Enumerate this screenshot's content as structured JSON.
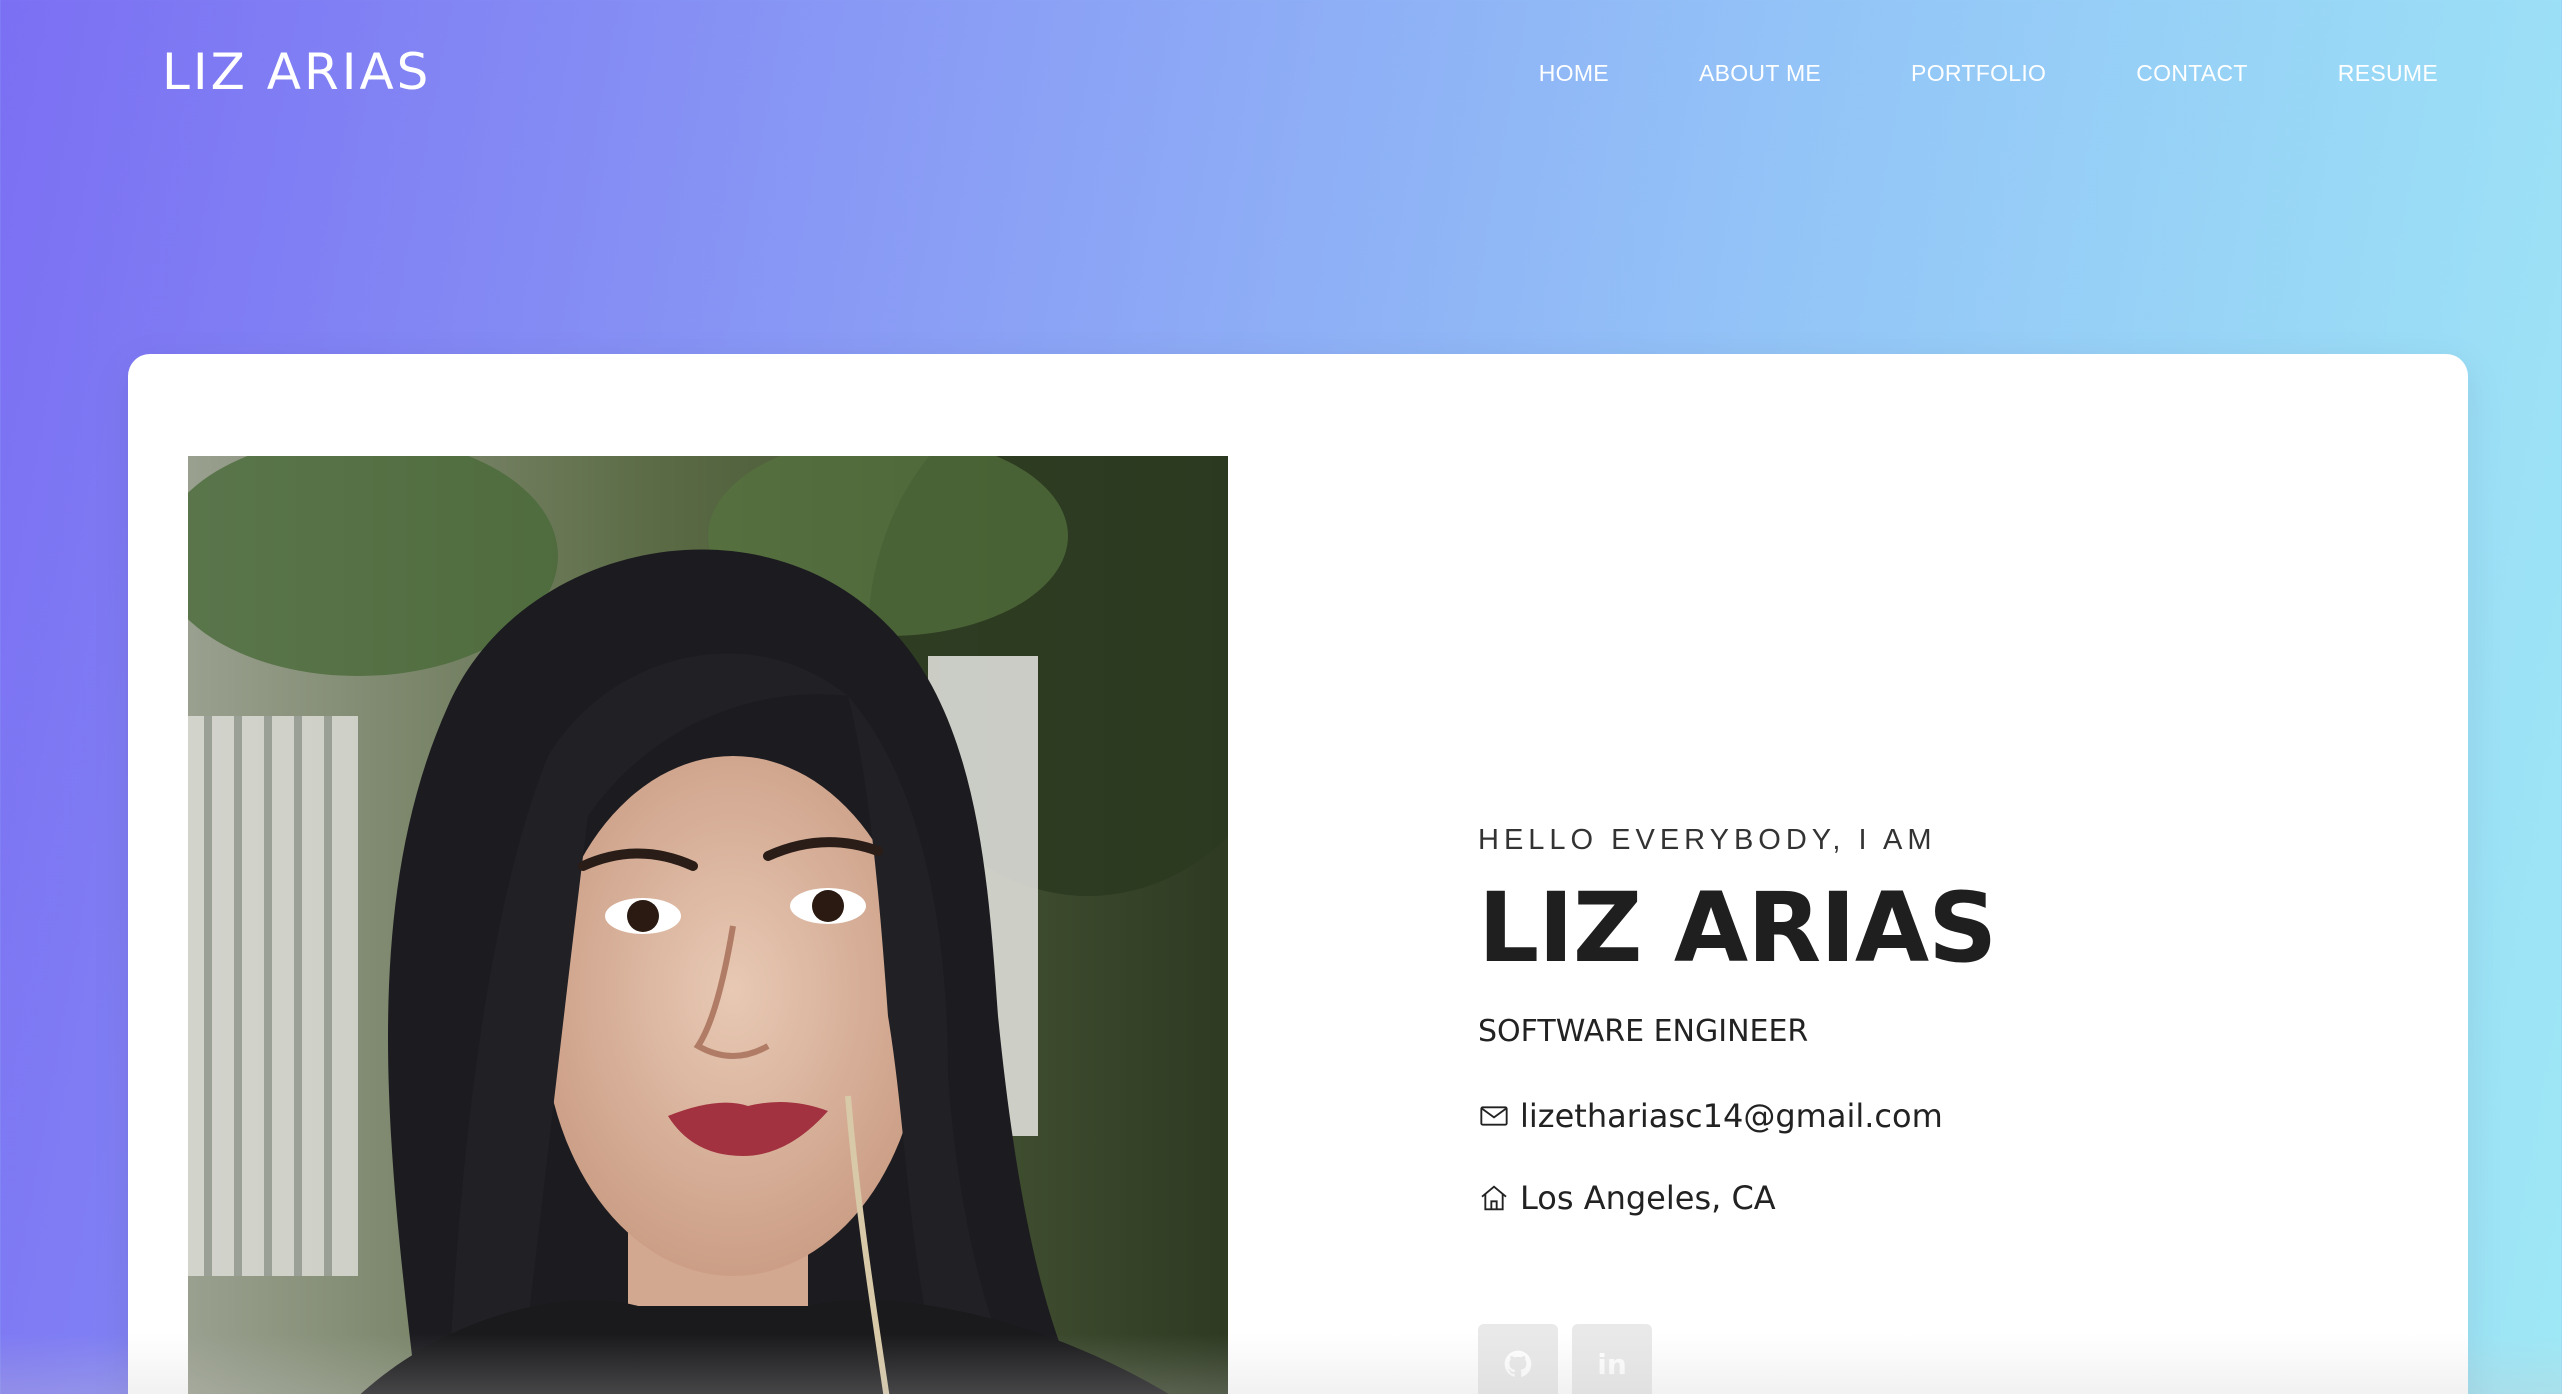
{
  "header": {
    "logo": "LIZ ARIAS",
    "nav": [
      {
        "label": "HOME"
      },
      {
        "label": "ABOUT ME"
      },
      {
        "label": "PORTFOLIO"
      },
      {
        "label": "CONTACT"
      },
      {
        "label": "RESUME"
      }
    ]
  },
  "hero": {
    "greeting": "HELLO EVERYBODY, I AM",
    "name": "LIZ ARIAS",
    "role": "SOFTWARE ENGINEER",
    "email": "lizethariasc14@gmail.com",
    "location": "Los Angeles, CA",
    "socials": [
      {
        "icon": "github-icon"
      },
      {
        "icon": "linkedin-icon"
      }
    ]
  },
  "colors": {
    "gradient_start": "#7b6ff3",
    "gradient_end": "#9ee8f6",
    "text_dark": "#1f1f1f",
    "social_bg": "#e9e9e9"
  }
}
